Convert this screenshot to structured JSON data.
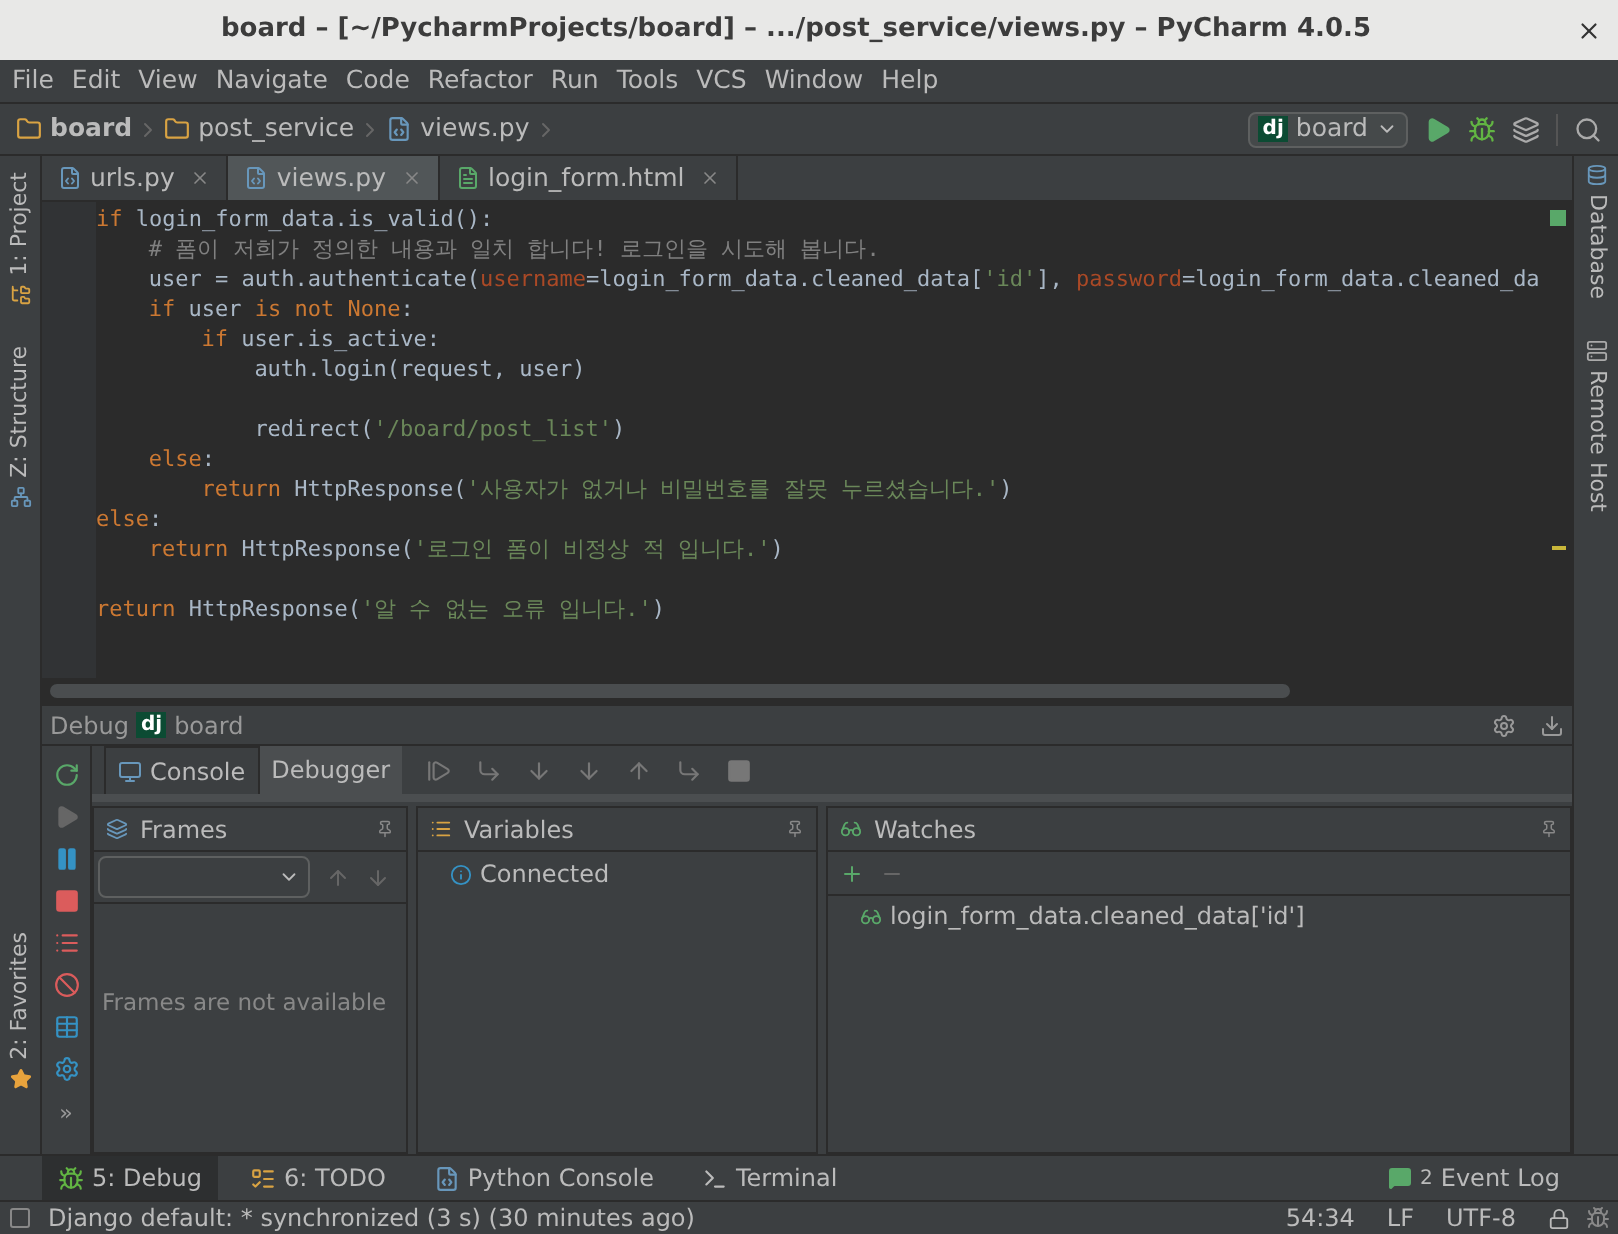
{
  "window": {
    "title": "board – [~/PycharmProjects/board] – .../post_service/views.py – PyCharm 4.0.5"
  },
  "menu": [
    "File",
    "Edit",
    "View",
    "Navigate",
    "Code",
    "Refactor",
    "Run",
    "Tools",
    "VCS",
    "Window",
    "Help"
  ],
  "breadcrumbs": [
    {
      "label": "board",
      "kind": "folder"
    },
    {
      "label": "post_service",
      "kind": "folder"
    },
    {
      "label": "views.py",
      "kind": "file"
    }
  ],
  "run_config": {
    "logo": "dj",
    "label": "board"
  },
  "left_tool_windows": [
    {
      "label": "1: Project",
      "kind": "top"
    },
    {
      "label": "Z: Structure",
      "kind": "top"
    },
    {
      "label": "2: Favorites",
      "kind": "bottom"
    }
  ],
  "right_tool_windows": [
    "Database",
    "Remote Host"
  ],
  "editor_tabs": [
    {
      "label": "urls.py",
      "kind": "python",
      "selected": false
    },
    {
      "label": "views.py",
      "kind": "python",
      "selected": true
    },
    {
      "label": "login_form.html",
      "kind": "html",
      "selected": false
    }
  ],
  "code": [
    {
      "kind": "line",
      "tokens": [
        {
          "text": "if",
          "kind": "keyword"
        },
        {
          "text": " login_form_data.is_valid():",
          "kind": "plain"
        }
      ],
      "children": [
        {
          "kind": "line",
          "tokens": [
            {
              "text": "# 폼이 저희가 정의한 내용과 일치 합니다! 로그인을 시도해 봅니다.",
              "kind": "comment"
            }
          ]
        },
        {
          "kind": "line",
          "tokens": [
            {
              "text": "user = auth.authenticate(",
              "kind": "plain"
            },
            {
              "text": "username",
              "kind": "param"
            },
            {
              "text": "=login_form_data.cleaned_data[",
              "kind": "plain"
            },
            {
              "text": "'id'",
              "kind": "string"
            },
            {
              "text": "], ",
              "kind": "plain"
            },
            {
              "text": "password",
              "kind": "param"
            },
            {
              "text": "=login_form_data.cleaned_da",
              "kind": "plain"
            }
          ]
        },
        {
          "kind": "line",
          "tokens": [
            {
              "text": "if",
              "kind": "keyword"
            },
            {
              "text": " user ",
              "kind": "plain"
            },
            {
              "text": "is not None",
              "kind": "keyword"
            },
            {
              "text": ":",
              "kind": "plain"
            }
          ],
          "children": [
            {
              "kind": "line",
              "tokens": [
                {
                  "text": "if",
                  "kind": "keyword"
                },
                {
                  "text": " user.is_active:",
                  "kind": "plain"
                }
              ],
              "children": [
                {
                  "kind": "line",
                  "tokens": [
                    {
                      "text": "auth.login(request, user)",
                      "kind": "plain"
                    }
                  ]
                },
                {
                  "kind": "blank"
                },
                {
                  "kind": "line",
                  "tokens": [
                    {
                      "text": "redirect(",
                      "kind": "plain"
                    },
                    {
                      "text": "'/board/post_list'",
                      "kind": "string"
                    },
                    {
                      "text": ")",
                      "kind": "plain"
                    }
                  ]
                }
              ]
            }
          ]
        },
        {
          "kind": "line",
          "tokens": [
            {
              "text": "else",
              "kind": "keyword"
            },
            {
              "text": ":",
              "kind": "plain"
            }
          ],
          "children": [
            {
              "kind": "line",
              "tokens": [
                {
                  "text": "return",
                  "kind": "keyword"
                },
                {
                  "text": " HttpResponse(",
                  "kind": "plain"
                },
                {
                  "text": "'사용자가 없거나 비밀번호를 잘못 누르셨습니다.'",
                  "kind": "string"
                },
                {
                  "text": ")",
                  "kind": "plain"
                }
              ]
            }
          ]
        }
      ]
    },
    {
      "kind": "line",
      "tokens": [
        {
          "text": "else",
          "kind": "keyword"
        },
        {
          "text": ":",
          "kind": "plain"
        }
      ],
      "children": [
        {
          "kind": "line",
          "tokens": [
            {
              "text": "return",
              "kind": "keyword"
            },
            {
              "text": " HttpResponse(",
              "kind": "plain"
            },
            {
              "text": "'로그인 폼이 비정상 적 입니다.'",
              "kind": "string"
            },
            {
              "text": ")",
              "kind": "plain"
            }
          ]
        }
      ]
    },
    {
      "kind": "blank"
    },
    {
      "kind": "line",
      "tokens": [
        {
          "text": "return",
          "kind": "keyword"
        },
        {
          "text": " HttpResponse(",
          "kind": "plain"
        },
        {
          "text": "'알 수 없는 오류 입니다.'",
          "kind": "string"
        },
        {
          "text": ")",
          "kind": "plain"
        }
      ]
    }
  ],
  "debug": {
    "title": "Debug",
    "logo": "dj",
    "config": "board",
    "tabs": [
      {
        "label": "Console",
        "selected": false
      },
      {
        "label": "Debugger",
        "selected": true
      }
    ],
    "more": "»",
    "frames": {
      "title": "Frames",
      "empty_text": "Frames are not available"
    },
    "variables": {
      "title": "Variables",
      "items": [
        "Connected"
      ]
    },
    "watches": {
      "title": "Watches",
      "items": [
        "login_form_data.cleaned_data['id']"
      ]
    }
  },
  "bottom_tabs": [
    {
      "label": "5: Debug",
      "kind": "debug",
      "selected": true
    },
    {
      "label": "6: TODO",
      "kind": "todo",
      "selected": false
    },
    {
      "label": "Python Console",
      "kind": "python",
      "selected": false
    },
    {
      "label": "Terminal",
      "kind": "terminal",
      "selected": false
    }
  ],
  "event_log": {
    "count": "2",
    "label": "Event Log"
  },
  "status_bar": {
    "message": "Django default: * synchronized (3 s) (30 minutes ago)",
    "position": "54:34",
    "line_separator": "LF",
    "encoding": "UTF-8"
  }
}
